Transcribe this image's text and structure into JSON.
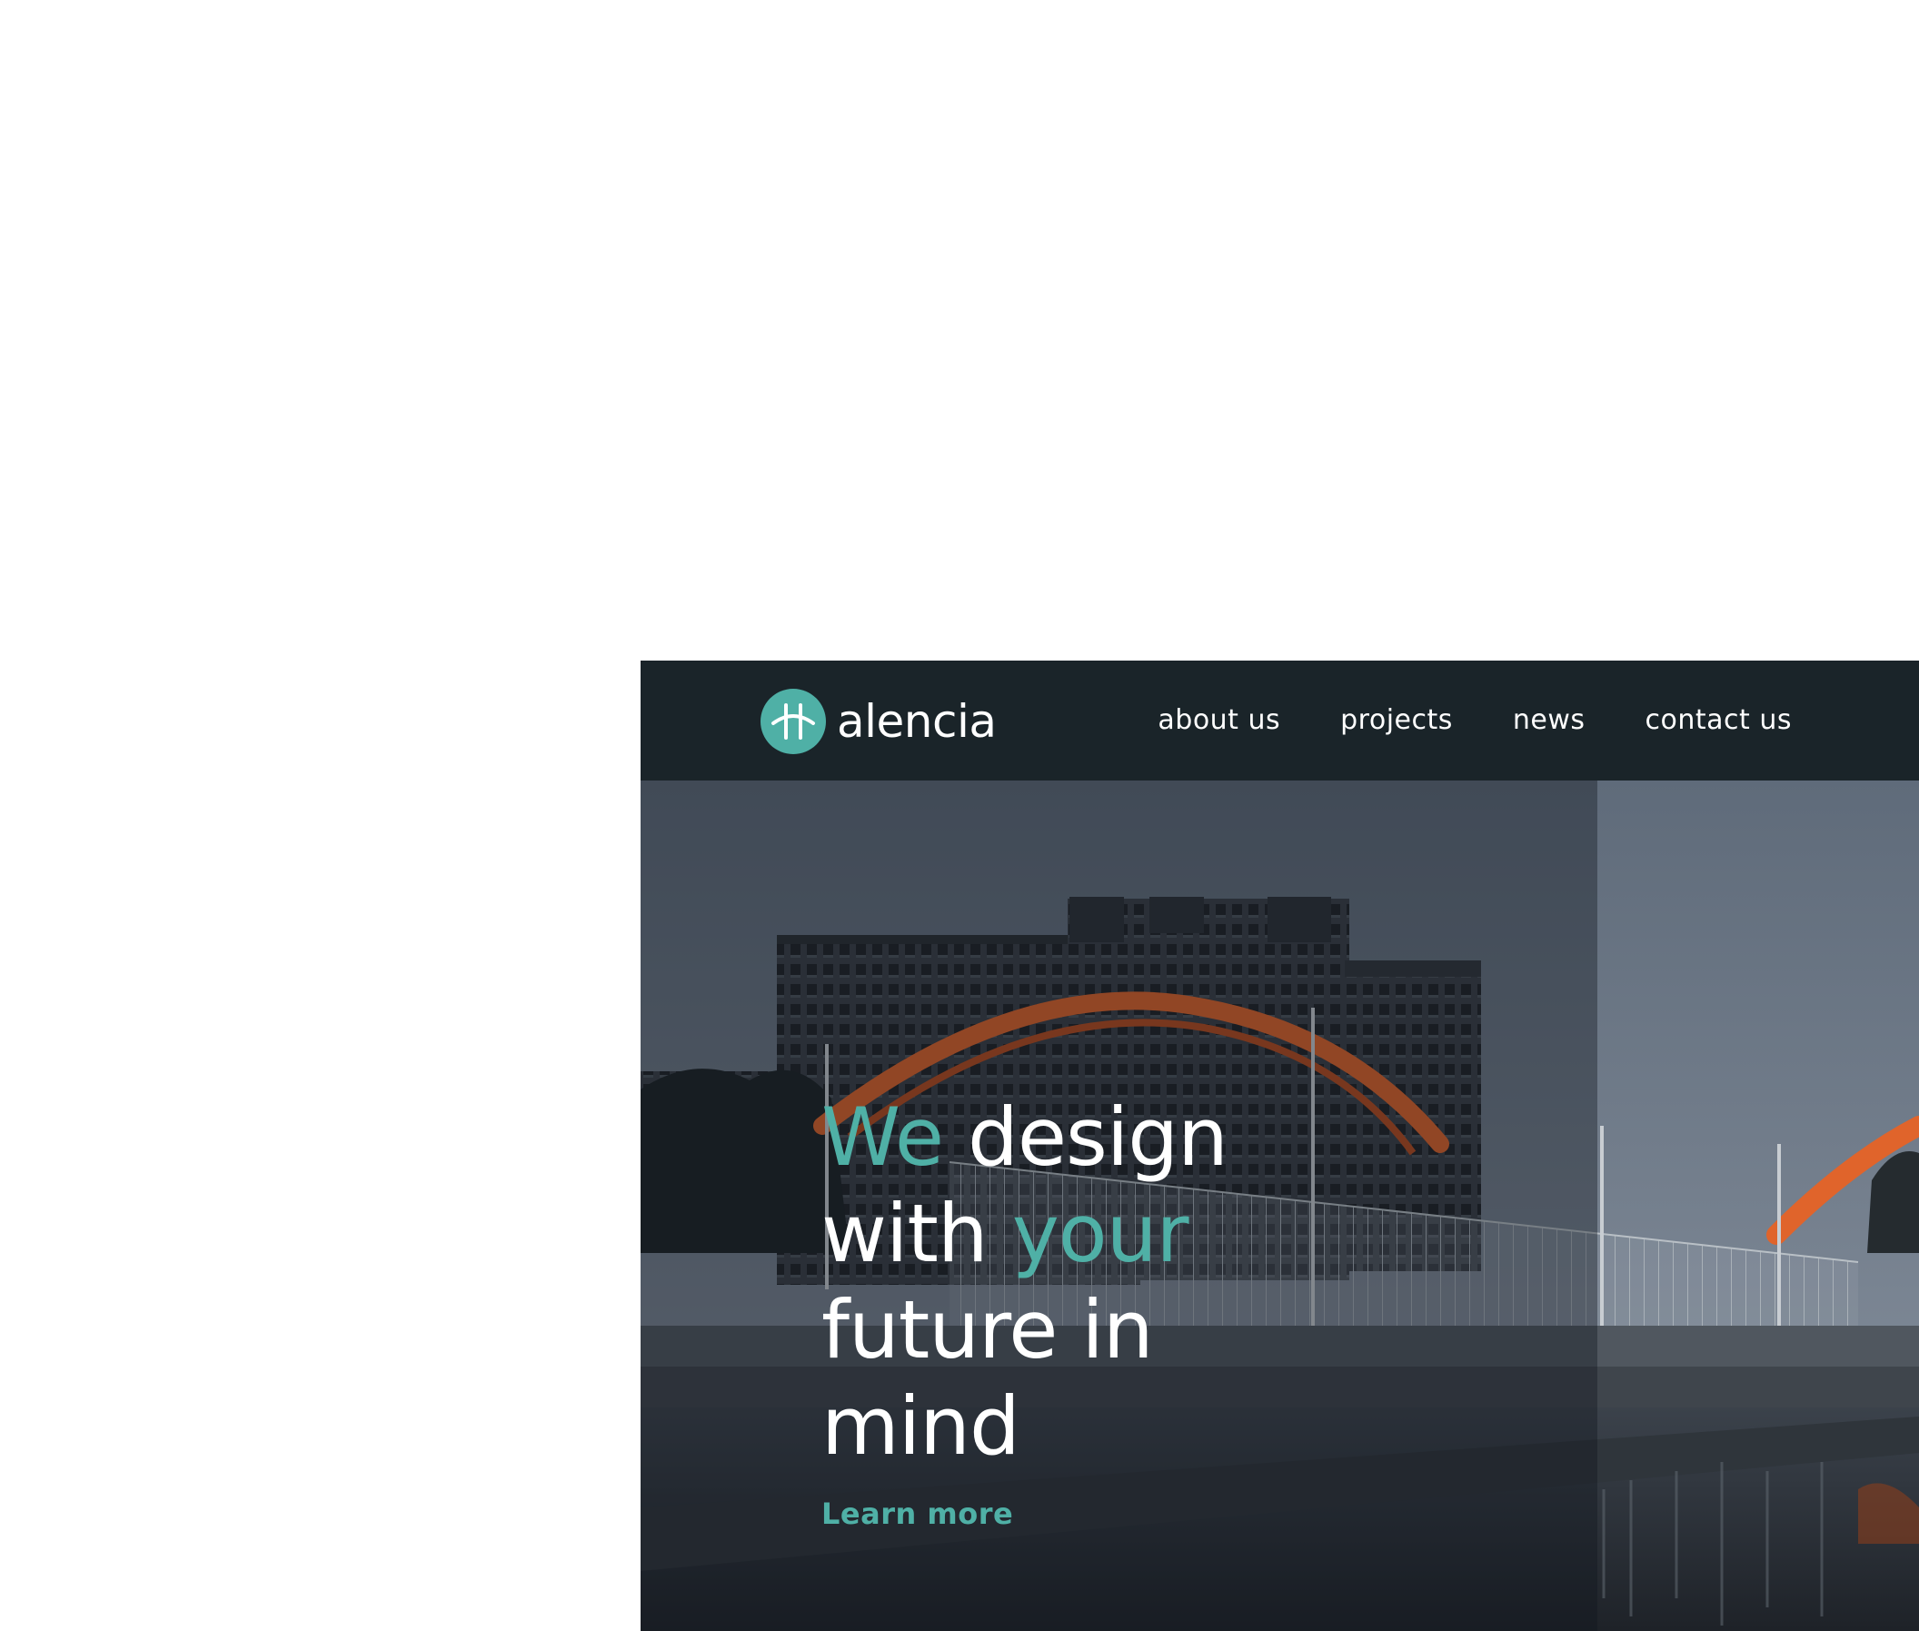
{
  "brand": {
    "name": "alencia",
    "logo_icon": "alencia-logo-icon",
    "accent_color": "#4fb0a6"
  },
  "nav": {
    "items": [
      "about us",
      "projects",
      "news",
      "contact us"
    ]
  },
  "hero": {
    "headline": {
      "w1": "We",
      "w2": "design",
      "w3": "with",
      "w4": "your",
      "w5": "future in",
      "w6": "mind"
    },
    "cta_label": "Learn more",
    "background_image": "city-bridge-river-photo"
  },
  "colors": {
    "header_bg": "#1a2429",
    "bridge": "#e0642b",
    "text": "#ffffff"
  }
}
